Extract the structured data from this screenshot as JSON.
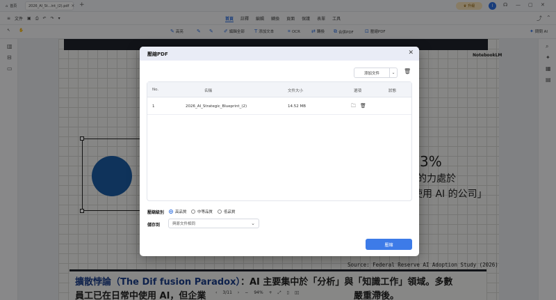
{
  "tabbar": {
    "home_label": "首頁",
    "doc_tab": "2026_AI_St...int_(2).pdf",
    "upgrade_label": "升級",
    "avatar": "I"
  },
  "menubar": {
    "file_label": "文件",
    "items": [
      "首頁",
      "註釋",
      "編輯",
      "轉換",
      "頁面",
      "保護",
      "表單",
      "工具"
    ],
    "active": "首頁"
  },
  "toolbar": {
    "items": [
      "高亮",
      "編輯全部",
      "添加文本",
      "OCR",
      "轉換",
      "合併PDF",
      "壓縮PDF"
    ],
    "ask_ai": "問問 AI"
  },
  "document": {
    "brand": "NotebookLM",
    "pct": "3%",
    "line1": "的力處於",
    "line2": "使用 AI 的公司」",
    "source": "Source: Federal Reserve AI Adoption Study (2026)",
    "bottom_title_strong": "擴散悖論（The Dif fusion Paradox）",
    "bottom_title_rest": "：AI 主要集中於「分析」與「知識工作」領域。多數",
    "bottom_line2": "員工已在日常中使用 AI，但企業",
    "bottom_line2_end": "嚴重滯後。"
  },
  "pagenav": {
    "page": "3/11",
    "zoom": "94%"
  },
  "dialog": {
    "title": "壓縮PDF",
    "add_file": "添加文件",
    "table": {
      "headers": [
        "No.",
        "名稱",
        "文件大小",
        "選項",
        "狀態"
      ],
      "rows": [
        {
          "no": "1",
          "name": "2026_AI_Strategic_Blueprint_(2)",
          "size": "14.52 MB",
          "status": ""
        }
      ]
    },
    "level_label": "壓縮級別",
    "levels": [
      "高品質",
      "中等品質",
      "低品質"
    ],
    "selected_level": "高品質",
    "save_label": "儲存到",
    "save_value": "與原文件相同",
    "compress_button": "壓縮"
  }
}
